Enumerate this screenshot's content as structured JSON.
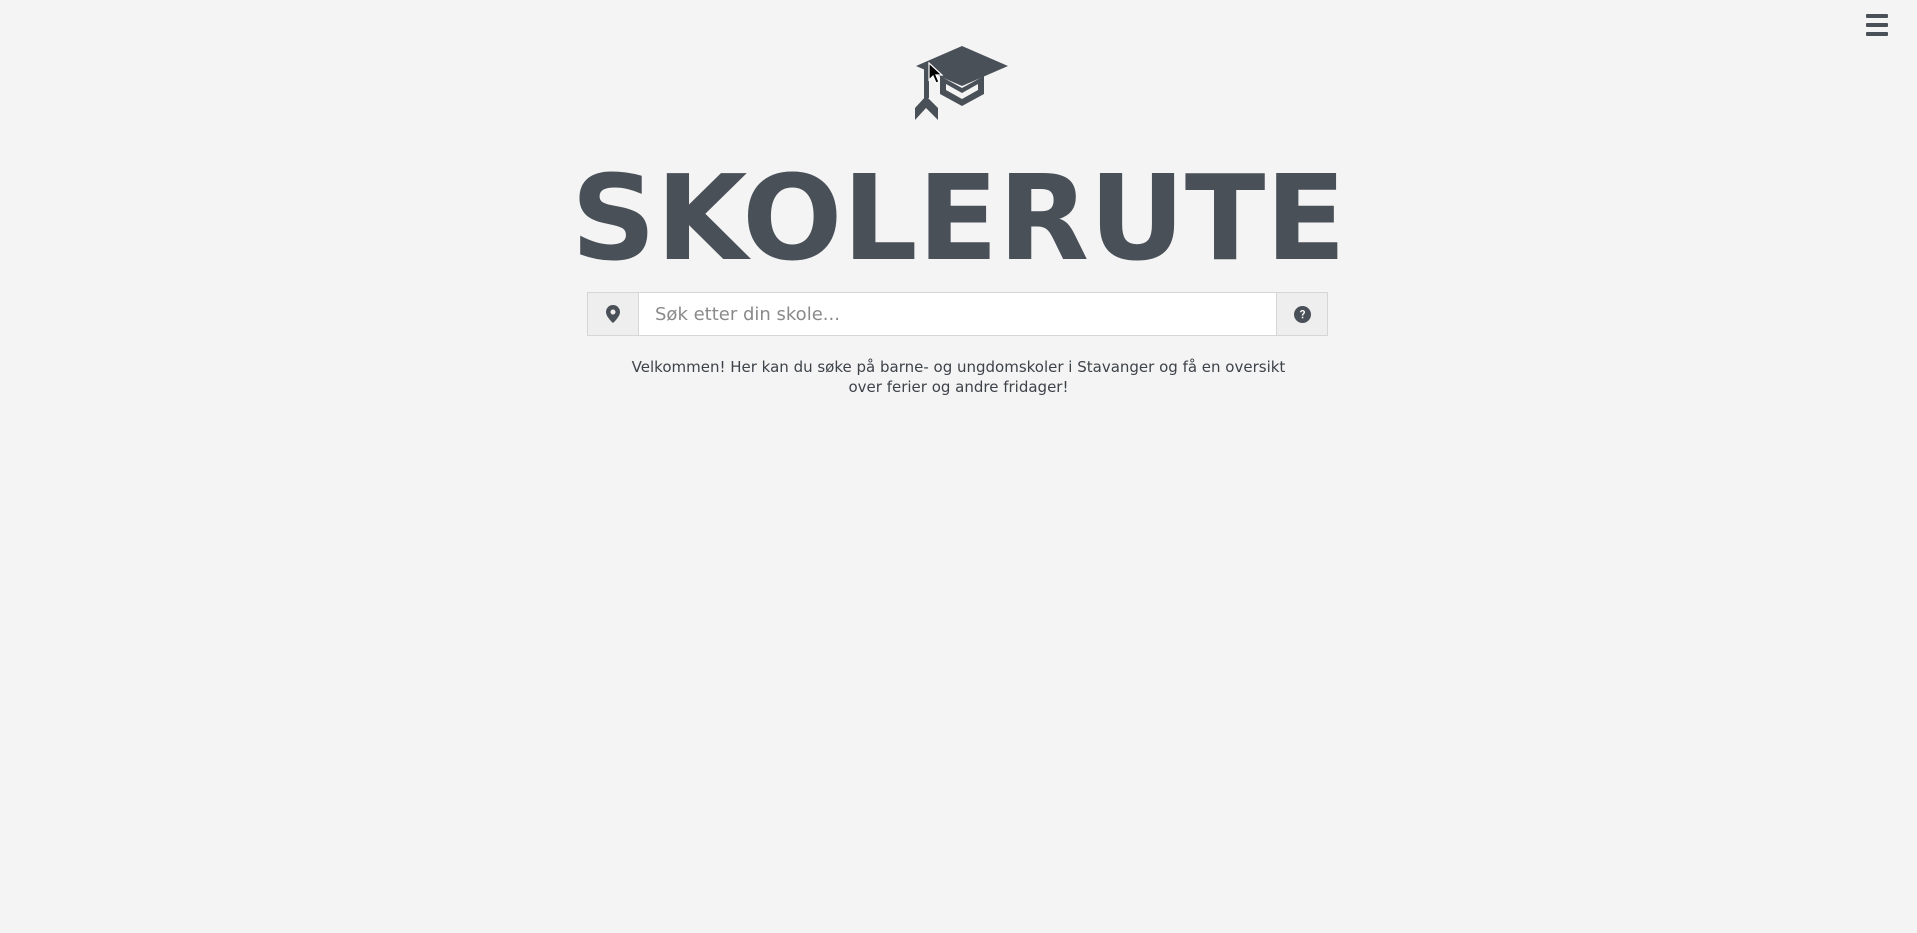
{
  "header": {
    "menu_icon": "hamburger-menu-icon",
    "logo_icon": "graduation-cap-icon"
  },
  "title": "SKOLERUTE",
  "search": {
    "placeholder": "Søk etter din skole...",
    "value": "",
    "location_icon": "map-marker-icon",
    "help_icon": "question-circle-icon"
  },
  "welcome": "Velkommen! Her kan du søke på barne- og ungdomskoler i Stavanger og få en oversikt over ferier og andre fridager!",
  "colors": {
    "background": "#f4f4f4",
    "text": "#4a5058",
    "addon_bg": "#eeeeee",
    "border": "#d6d6d6"
  }
}
